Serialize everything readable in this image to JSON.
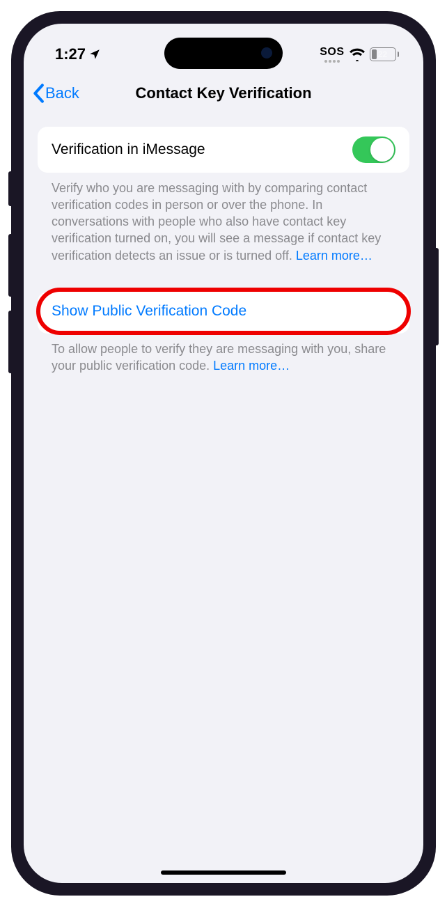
{
  "statusBar": {
    "time": "1:27",
    "sos": "SOS",
    "batteryPercent": "22"
  },
  "nav": {
    "back": "Back",
    "title": "Contact Key Verification"
  },
  "section1": {
    "toggleLabel": "Verification in iMessage",
    "footer": "Verify who you are messaging with by comparing contact verification codes in person or over the phone. In conversations with people who also have contact key verification turned on, you will see a message if contact key verification detects an issue or is turned off. ",
    "learnMore": "Learn more…"
  },
  "section2": {
    "showCode": "Show Public Verification Code",
    "footer": "To allow people to verify they are messaging with you, share your public verification code. ",
    "learnMore": "Learn more…"
  }
}
